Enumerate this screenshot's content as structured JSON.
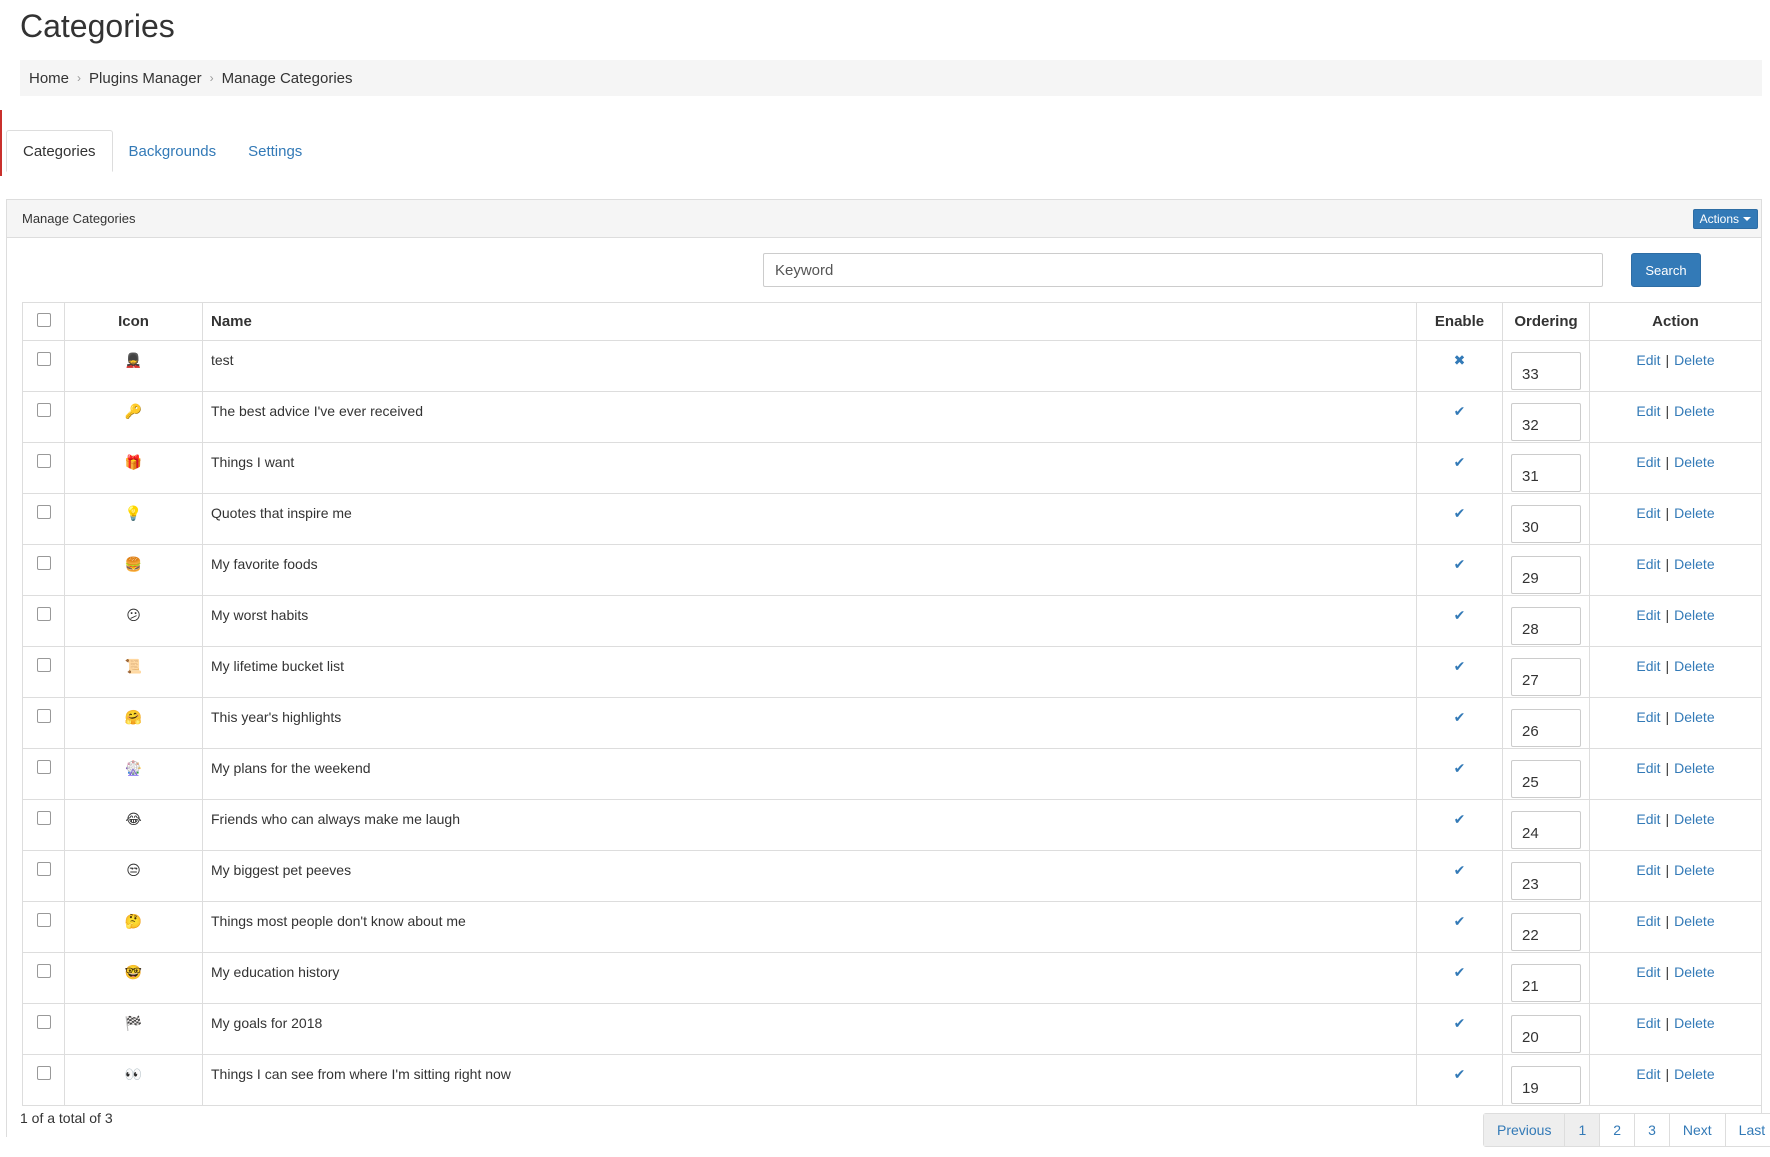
{
  "page": {
    "title": "Categories",
    "breadcrumb": [
      "Home",
      "Plugins Manager",
      "Manage Categories"
    ]
  },
  "tabs": [
    {
      "label": "Categories",
      "active": true
    },
    {
      "label": "Backgrounds",
      "active": false
    },
    {
      "label": "Settings",
      "active": false
    }
  ],
  "panel": {
    "heading": "Manage Categories",
    "actions_label": "Actions"
  },
  "search": {
    "placeholder": "Keyword",
    "button_label": "Search"
  },
  "table": {
    "headers": {
      "icon": "Icon",
      "name": "Name",
      "enable": "Enable",
      "ordering": "Ordering",
      "action": "Action"
    },
    "edit_label": "Edit",
    "separator": "|",
    "delete_label": "Delete",
    "rows": [
      {
        "icon": "💂",
        "name": "test",
        "enabled": false,
        "ordering": "33"
      },
      {
        "icon": "🔑",
        "name": "The best advice I've ever received",
        "enabled": true,
        "ordering": "32"
      },
      {
        "icon": "🎁",
        "name": "Things I want",
        "enabled": true,
        "ordering": "31"
      },
      {
        "icon": "💡",
        "name": "Quotes that inspire me",
        "enabled": true,
        "ordering": "30"
      },
      {
        "icon": "🍔",
        "name": "My favorite foods",
        "enabled": true,
        "ordering": "29"
      },
      {
        "icon": "😕",
        "name": "My worst habits",
        "enabled": true,
        "ordering": "28"
      },
      {
        "icon": "📜",
        "name": "My lifetime bucket list",
        "enabled": true,
        "ordering": "27"
      },
      {
        "icon": "🤗",
        "name": "This year's highlights",
        "enabled": true,
        "ordering": "26"
      },
      {
        "icon": "🎡",
        "name": "My plans for the weekend",
        "enabled": true,
        "ordering": "25"
      },
      {
        "icon": "😂",
        "name": "Friends who can always make me laugh",
        "enabled": true,
        "ordering": "24"
      },
      {
        "icon": "😒",
        "name": "My biggest pet peeves",
        "enabled": true,
        "ordering": "23"
      },
      {
        "icon": "🤔",
        "name": "Things most people don't know about me",
        "enabled": true,
        "ordering": "22"
      },
      {
        "icon": "🤓",
        "name": "My education history",
        "enabled": true,
        "ordering": "21"
      },
      {
        "icon": "🏁",
        "name": "My goals for 2018",
        "enabled": true,
        "ordering": "20"
      },
      {
        "icon": "👀",
        "name": "Things I can see from where I'm sitting right now",
        "enabled": true,
        "ordering": "19"
      }
    ]
  },
  "marks": {
    "enabled": "✔",
    "disabled": "✖"
  },
  "pagination": {
    "summary": "1 of a total of 3",
    "previous": "Previous",
    "pages": [
      "1",
      "2",
      "3"
    ],
    "next": "Next",
    "last": "Last"
  },
  "colors": {
    "accent": "#337ab7",
    "border": "#dddddd"
  }
}
